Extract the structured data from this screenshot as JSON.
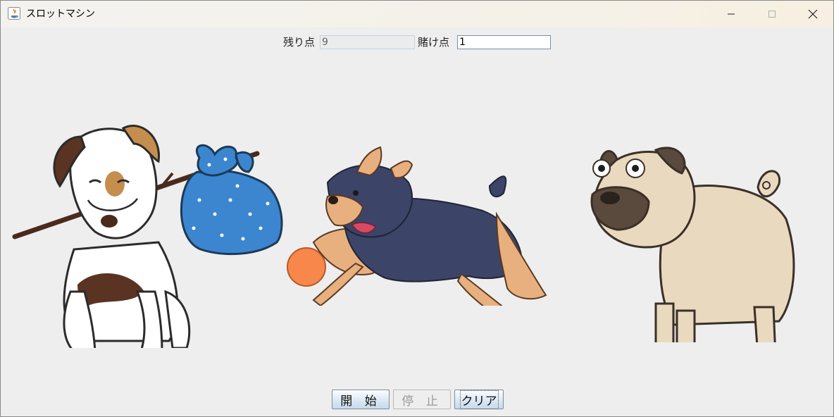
{
  "window": {
    "title": "スロットマシン",
    "controls": {
      "minimize": "minimize-icon",
      "maximize": "maximize-icon",
      "close": "close-icon"
    }
  },
  "scoreboard": {
    "remaining_label": "残り点",
    "remaining_value": "9",
    "bet_label": "賭け点",
    "bet_value": "1"
  },
  "slots": [
    {
      "name": "slot-1",
      "picture": "jack-russell-with-bindle"
    },
    {
      "name": "slot-2",
      "picture": "yorkshire-terrier-with-ball"
    },
    {
      "name": "slot-3",
      "picture": "pug"
    }
  ],
  "buttons": {
    "start": "開 始",
    "stop": "停 止",
    "clear": "クリア"
  },
  "colors": {
    "window_bg": "#eeeeee",
    "button_top": "#fcfdff",
    "button_bottom": "#c8d9ea",
    "disabled_text": "#9a9a9a"
  }
}
